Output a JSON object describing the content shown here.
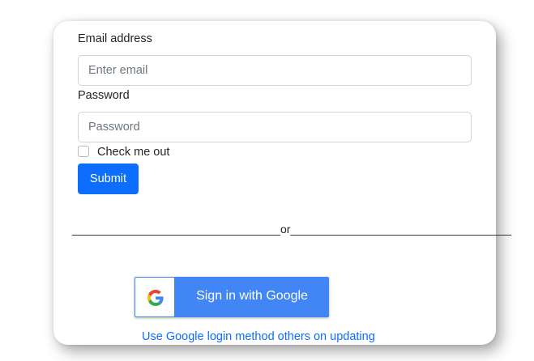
{
  "form": {
    "email_label": "Email address",
    "email_placeholder": "Enter email",
    "email_value": "",
    "password_label": "Password",
    "password_placeholder": "Password",
    "password_value": "",
    "remember_label": "Check me out",
    "submit_label": "Submit"
  },
  "divider_text": "_________________________________or___________________________________",
  "google": {
    "button_label": "Sign in with Google",
    "icon": "google-g-icon",
    "button_color": "#4285f4"
  },
  "note_link": "Use Google login method others on updating",
  "colors": {
    "primary": "#0d6efd",
    "text": "#212529"
  }
}
